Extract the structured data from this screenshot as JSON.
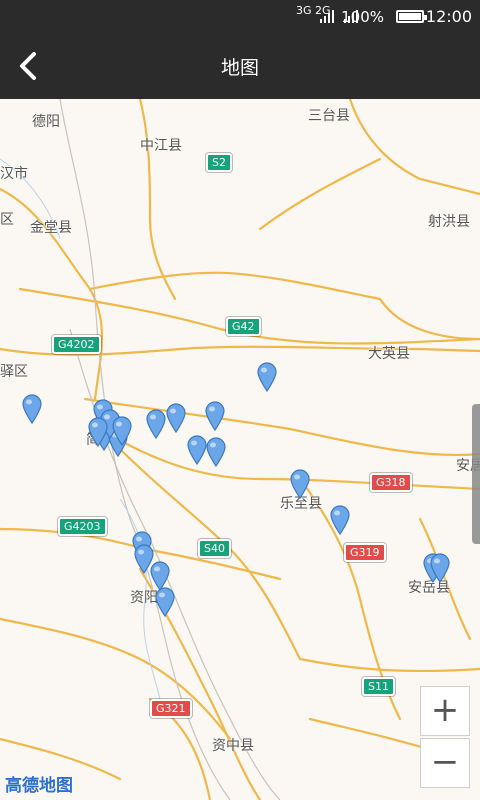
{
  "status": {
    "battery": "100%",
    "time": "12:00",
    "network": "3G 2G"
  },
  "nav": {
    "title": "地图"
  },
  "map": {
    "labels": [
      {
        "text": "德阳"
      },
      {
        "text": "中江县"
      },
      {
        "text": "三台县"
      },
      {
        "text": "汉市"
      },
      {
        "text": "区"
      },
      {
        "text": "金堂县"
      },
      {
        "text": "射洪县"
      },
      {
        "text": "大英县"
      },
      {
        "text": "驿区"
      },
      {
        "text": "简"
      },
      {
        "text": "乐至县"
      },
      {
        "text": "安居"
      },
      {
        "text": "安岳县"
      },
      {
        "text": "资阳"
      },
      {
        "text": "资中县"
      }
    ],
    "shields": [
      {
        "text": "S2",
        "color": "green"
      },
      {
        "text": "G42",
        "color": "green"
      },
      {
        "text": "G4202",
        "color": "green"
      },
      {
        "text": "G318",
        "color": "red"
      },
      {
        "text": "G319",
        "color": "red"
      },
      {
        "text": "G4203",
        "color": "green"
      },
      {
        "text": "S40",
        "color": "green"
      },
      {
        "text": "G321",
        "color": "red"
      },
      {
        "text": "S11",
        "color": "green"
      }
    ],
    "pin_count": 22
  },
  "zoom": {
    "in": "+",
    "out": "−"
  },
  "logo": "高德地图"
}
